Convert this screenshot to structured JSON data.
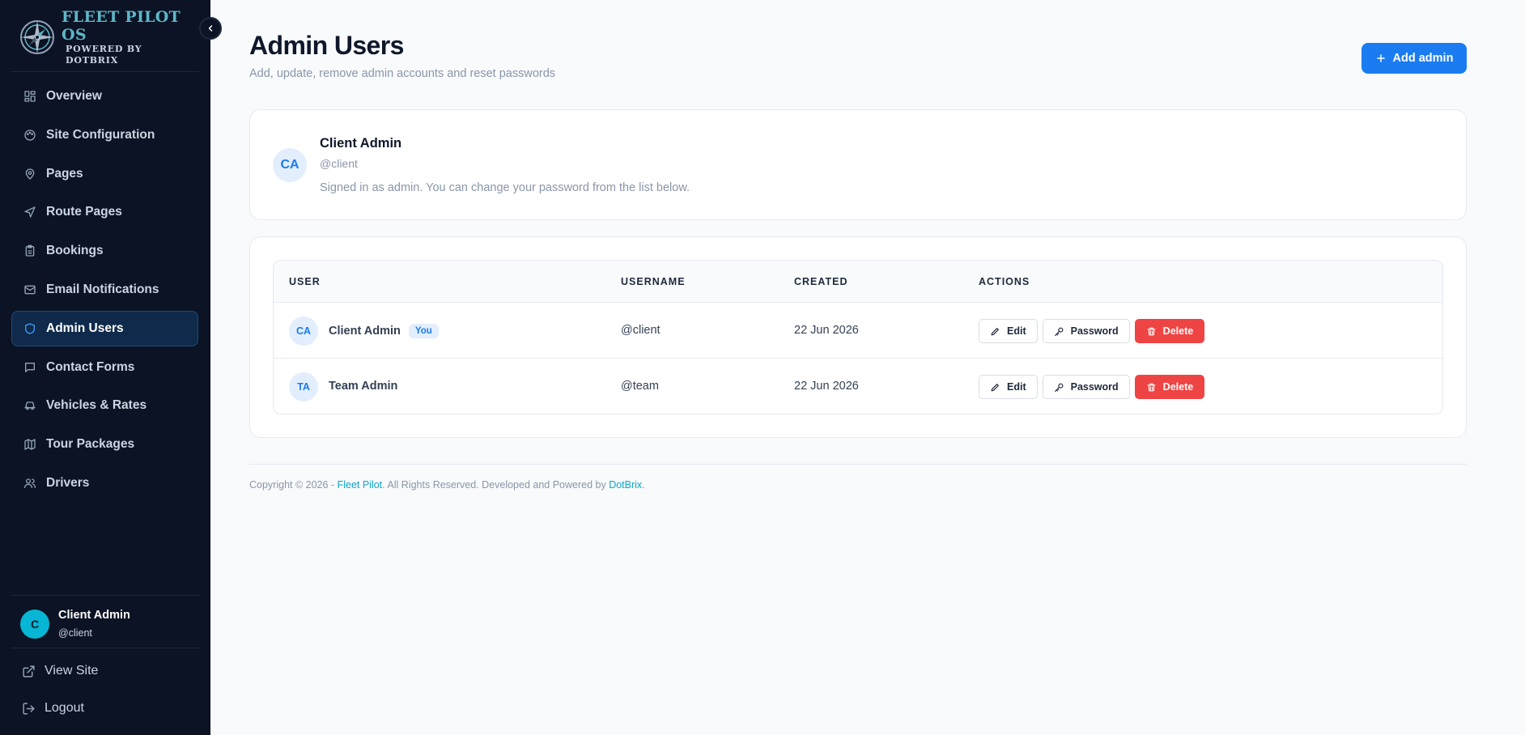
{
  "brand": {
    "title": "FLEET PILOT OS",
    "subtitle": "POWERED BY DOTBRIX"
  },
  "sidebar": {
    "items": [
      {
        "label": "Overview",
        "icon": "grid-icon",
        "active": false
      },
      {
        "label": "Site Configuration",
        "icon": "palette-icon",
        "active": false
      },
      {
        "label": "Pages",
        "icon": "map-pin-icon",
        "active": false
      },
      {
        "label": "Route Pages",
        "icon": "navigation-icon",
        "active": false
      },
      {
        "label": "Bookings",
        "icon": "clipboard-icon",
        "active": false
      },
      {
        "label": "Email Notifications",
        "icon": "mail-icon",
        "active": false
      },
      {
        "label": "Admin Users",
        "icon": "shield-icon",
        "active": true
      },
      {
        "label": "Contact Forms",
        "icon": "message-square-icon",
        "active": false
      },
      {
        "label": "Vehicles & Rates",
        "icon": "car-icon",
        "active": false
      },
      {
        "label": "Tour Packages",
        "icon": "map-icon",
        "active": false
      },
      {
        "label": "Drivers",
        "icon": "users-icon",
        "active": false
      }
    ],
    "user": {
      "initial": "C",
      "name": "Client Admin",
      "handle": "@client"
    },
    "view_site": "View Site",
    "logout": "Logout"
  },
  "header": {
    "title": "Admin Users",
    "subtitle": "Add, update, remove admin accounts and reset passwords",
    "add_button": "Add admin"
  },
  "profile": {
    "initials": "CA",
    "name": "Client Admin",
    "handle": "@client",
    "note": "Signed in as admin. You can change your password from the list below."
  },
  "table": {
    "columns": [
      "USER",
      "USERNAME",
      "CREATED",
      "ACTIONS"
    ],
    "rows": [
      {
        "initials": "CA",
        "name": "Client Admin",
        "badge": "You",
        "username": "@client",
        "created": "22 Jun 2026"
      },
      {
        "initials": "TA",
        "name": "Team Admin",
        "badge": "",
        "username": "@team",
        "created": "22 Jun 2026"
      }
    ],
    "actions": {
      "edit": "Edit",
      "password": "Password",
      "delete": "Delete"
    }
  },
  "footer": {
    "prefix": "Copyright © 2026 - ",
    "brand_link": "Fleet Pilot",
    "middle": ". All Rights Reserved. Developed and Powered by ",
    "dev_link": "DotBrix",
    "suffix": "."
  },
  "colors": {
    "sidebar_bg": "#0b1324",
    "accent": "#1a7cf0",
    "danger": "#ef4444",
    "teal": "#06b6d4"
  }
}
